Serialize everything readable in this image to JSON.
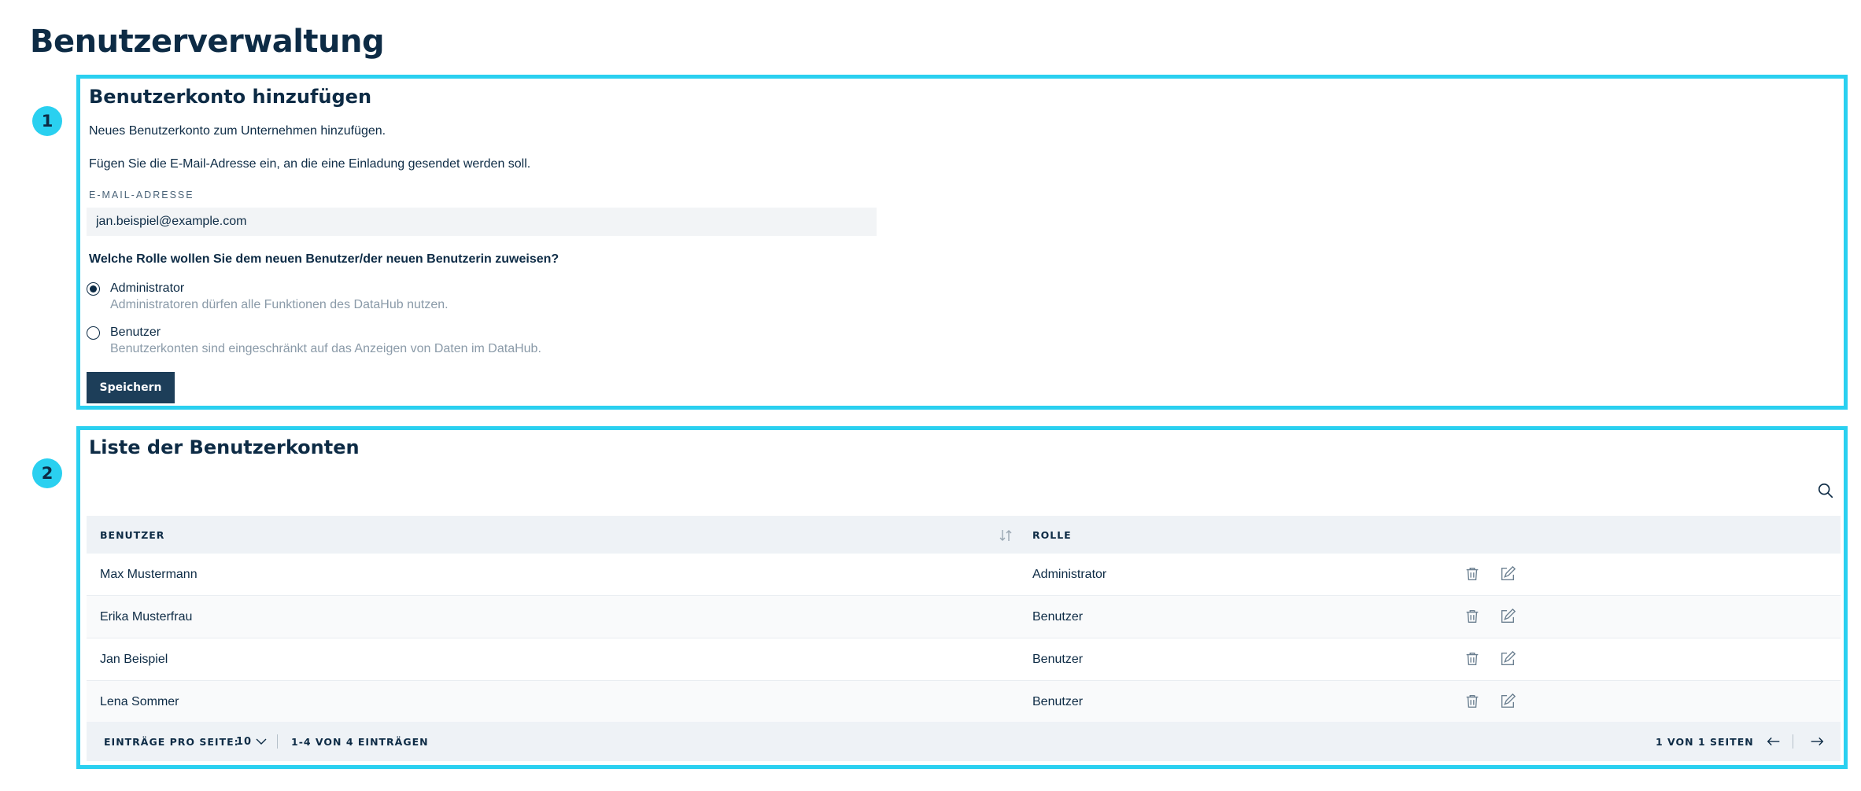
{
  "page": {
    "title": "Benutzerverwaltung"
  },
  "markers": [
    "1",
    "2"
  ],
  "add_account": {
    "title": "Benutzerkonto hinzufügen",
    "description": "Neues Benutzerkonto zum Unternehmen hinzufügen.",
    "instruction": "Fügen Sie die E-Mail-Adresse ein, an die eine Einladung gesendet werden soll.",
    "email_label": "E-MAIL-ADRESSE",
    "email_value": "jan.beispiel@example.com",
    "role_question": "Welche Rolle wollen Sie dem neuen Benutzer/der neuen Benutzerin zuweisen?",
    "roles": [
      {
        "label": "Administrator",
        "description": "Administratoren dürfen alle Funktionen des DataHub nutzen.",
        "selected": true
      },
      {
        "label": "Benutzer",
        "description": "Benutzerkonten sind eingeschränkt auf das Anzeigen von Daten im DataHub.",
        "selected": false
      }
    ],
    "save_label": "Speichern"
  },
  "account_list": {
    "title": "Liste der Benutzerkonten",
    "columns": {
      "user": "BENUTZER",
      "role": "ROLLE"
    },
    "rows": [
      {
        "user": "Max Mustermann",
        "role": "Administrator"
      },
      {
        "user": "Erika Musterfrau",
        "role": "Benutzer"
      },
      {
        "user": "Jan Beispiel",
        "role": "Benutzer"
      },
      {
        "user": "Lena Sommer",
        "role": "Benutzer"
      }
    ],
    "pagination": {
      "per_page_label": "EINTRÄGE PRO SEITE:",
      "per_page_value": "10",
      "range_label": "1-4 VON 4 EINTRÄGEN",
      "pages_label": "1 VON 1 SEITEN"
    }
  },
  "colors": {
    "accent": "#2ad0f0",
    "primary": "#1d3e59",
    "text": "#0d2b45",
    "muted": "#8a9aa8"
  },
  "icons": [
    "search-icon",
    "sort-icon",
    "trash-icon",
    "edit-icon",
    "chevron-down-icon",
    "arrow-left-icon",
    "arrow-right-icon"
  ]
}
